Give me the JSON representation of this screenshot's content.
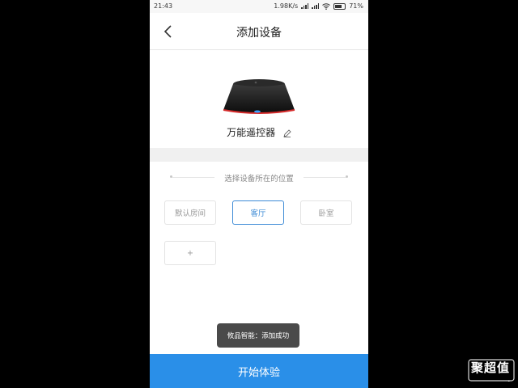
{
  "status_bar": {
    "time": "21:43",
    "network_speed": "1.98K/s",
    "battery": "71%"
  },
  "header": {
    "title": "添加设备"
  },
  "device": {
    "name": "万能遥控器"
  },
  "location": {
    "title": "选择设备所在的位置",
    "rooms": [
      {
        "label": "默认房间",
        "selected": false
      },
      {
        "label": "客厅",
        "selected": true
      },
      {
        "label": "卧室",
        "selected": false
      }
    ],
    "add_label": "+"
  },
  "toast": {
    "text": "攸品智能：添加成功"
  },
  "footer": {
    "start_label": "开始体验"
  },
  "watermark": {
    "text": "聚超值"
  },
  "colors": {
    "accent": "#2a8fe8",
    "selected_border": "#3d8bd6",
    "toast_bg": "#4a4a4a"
  }
}
